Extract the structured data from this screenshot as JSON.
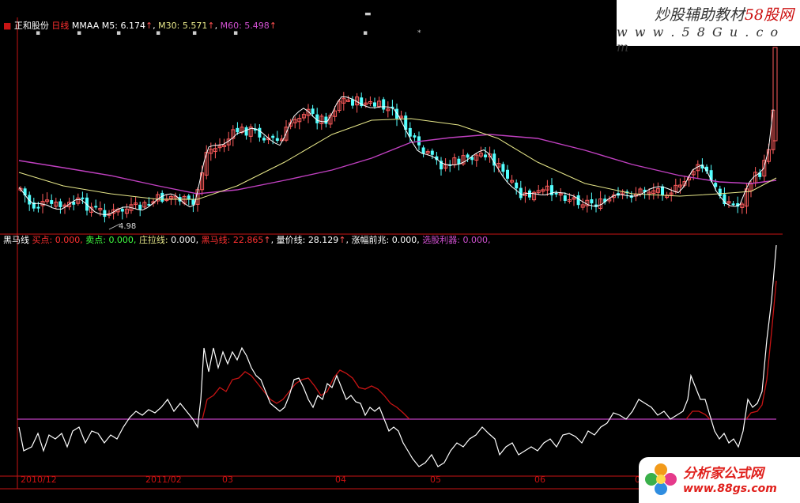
{
  "main_panel": {
    "stock_name": "正和股份",
    "period": "日线",
    "indicator": "MMAA",
    "ma5_label": "M5:",
    "ma5_value": "6.174",
    "ma30_label": "M30:",
    "ma30_value": "5.571",
    "ma60_label": "M60:",
    "ma60_value": "5.498",
    "up_arrow": "↑",
    "low_marker": "4.98"
  },
  "sub_panel": {
    "name": "黑马线",
    "buy_label": "买点:",
    "buy_value": "0.000,",
    "sell_label": "卖点:",
    "sell_value": "0.000,",
    "zhuangla_label": "庄拉线:",
    "zhuangla_value": "0.000,",
    "heima_label": "黑马线:",
    "heima_value": "22.865",
    "liangjia_label": "量价线:",
    "liangjia_value": "28.129",
    "zhangfu_label": "涨幅前兆:",
    "zhangfu_value": "0.000,",
    "xuangu_label": "选股利器:",
    "xuangu_value": "0.000,"
  },
  "x_axis": [
    "2010/12",
    "2011/02",
    "03",
    "04",
    "05",
    "06",
    "0"
  ],
  "watermark_top": {
    "line1_a": "炒股辅助教材",
    "line1_b": "58股网",
    "line2": "w w w . 5 8 G u . c o m"
  },
  "watermark_bottom": {
    "line1": "分析家公式网",
    "line2": "www.88gs.com"
  },
  "colors": {
    "up": "#ff5c5c",
    "down": "#54ffff",
    "ma5": "#ffffff",
    "ma30": "#e8e88a",
    "ma60": "#c040c0",
    "heima_line": "#c81414",
    "liangjia_line": "#ffffff",
    "zero_line": "#c040c0",
    "frame": "#c81414"
  }
}
